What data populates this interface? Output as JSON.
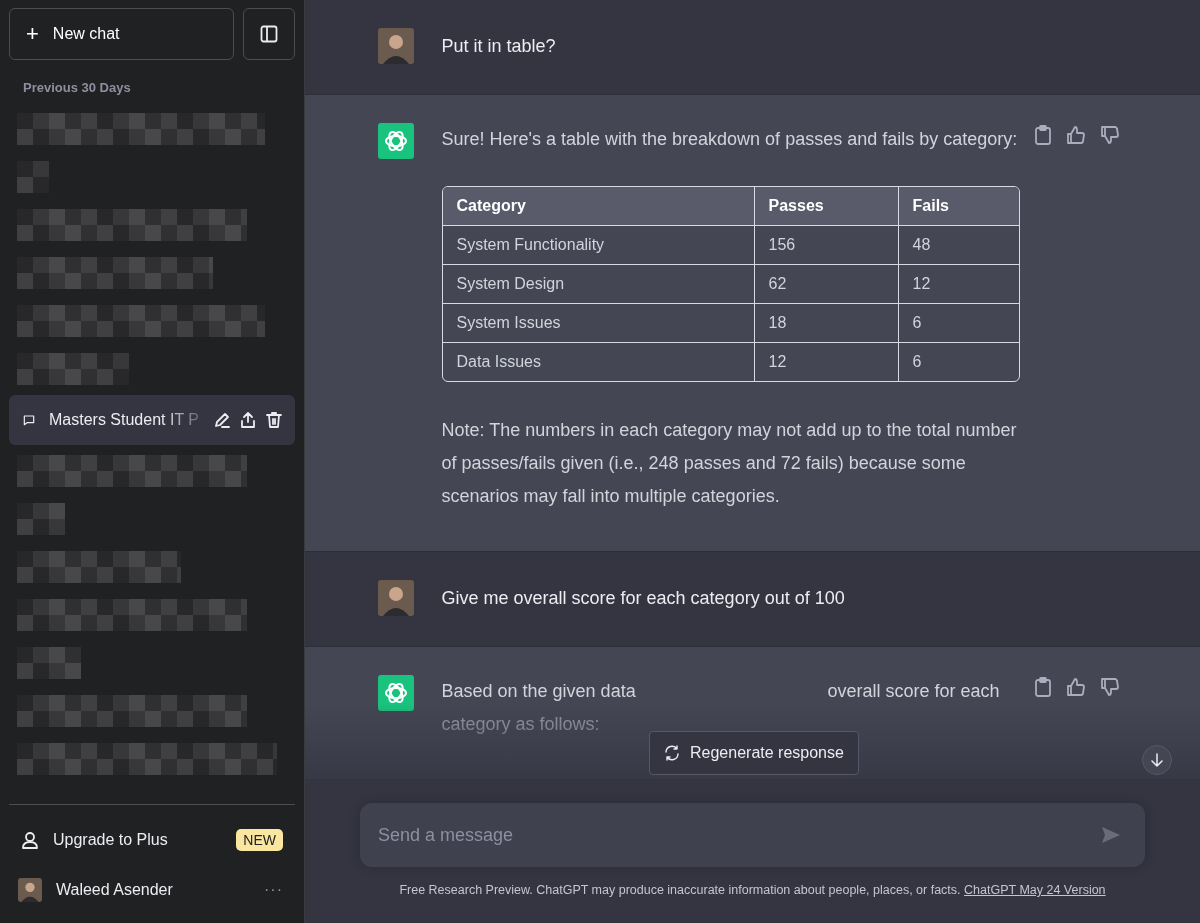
{
  "sidebar": {
    "new_chat": {
      "icon": "+",
      "label": "New chat"
    },
    "section_title": "Previous 30 Days",
    "history": [
      {
        "kind": "redacted"
      },
      {
        "kind": "redacted"
      },
      {
        "kind": "redacted"
      },
      {
        "kind": "redacted"
      },
      {
        "kind": "redacted"
      },
      {
        "kind": "redacted"
      },
      {
        "kind": "chat",
        "title": "Masters Student IT P",
        "selected": true
      },
      {
        "kind": "redacted"
      },
      {
        "kind": "redacted"
      },
      {
        "kind": "redacted"
      },
      {
        "kind": "redacted"
      },
      {
        "kind": "redacted"
      },
      {
        "kind": "redacted"
      },
      {
        "kind": "redacted"
      }
    ],
    "upgrade": {
      "label": "Upgrade to Plus",
      "badge": "NEW"
    },
    "user": {
      "name": "Waleed Asender",
      "menu": "···"
    }
  },
  "conversation": [
    {
      "kind": "user",
      "text": "Put it in table?"
    },
    {
      "kind": "assistant",
      "intro": "Sure! Here's a table with the breakdown of passes and fails by category:",
      "table": {
        "columns": [
          "Category",
          "Passes",
          "Fails"
        ],
        "rows": [
          [
            "System Functionality",
            "156",
            "48"
          ],
          [
            "System Design",
            "62",
            "12"
          ],
          [
            "System Issues",
            "18",
            "6"
          ],
          [
            "Data Issues",
            "12",
            "6"
          ]
        ]
      },
      "note": "Note: The numbers in each category may not add up to the total number of passes/fails given (i.e., 248 passes and 72 fails) because some scenarios may fall into multiple categories."
    },
    {
      "kind": "user",
      "text": "Give me overall score for each category out of 100"
    },
    {
      "kind": "assistant",
      "partial": {
        "line1_start": "Based on the given data",
        "line1_end": "overall score for each",
        "line2": "category as follows:"
      }
    }
  ],
  "regenerate": {
    "label": "Regenerate response"
  },
  "composer": {
    "placeholder": "Send a message"
  },
  "footer": {
    "text": "Free Research Preview. ChatGPT may produce inaccurate information about people, places, or facts.",
    "link": "ChatGPT May 24 Version"
  }
}
